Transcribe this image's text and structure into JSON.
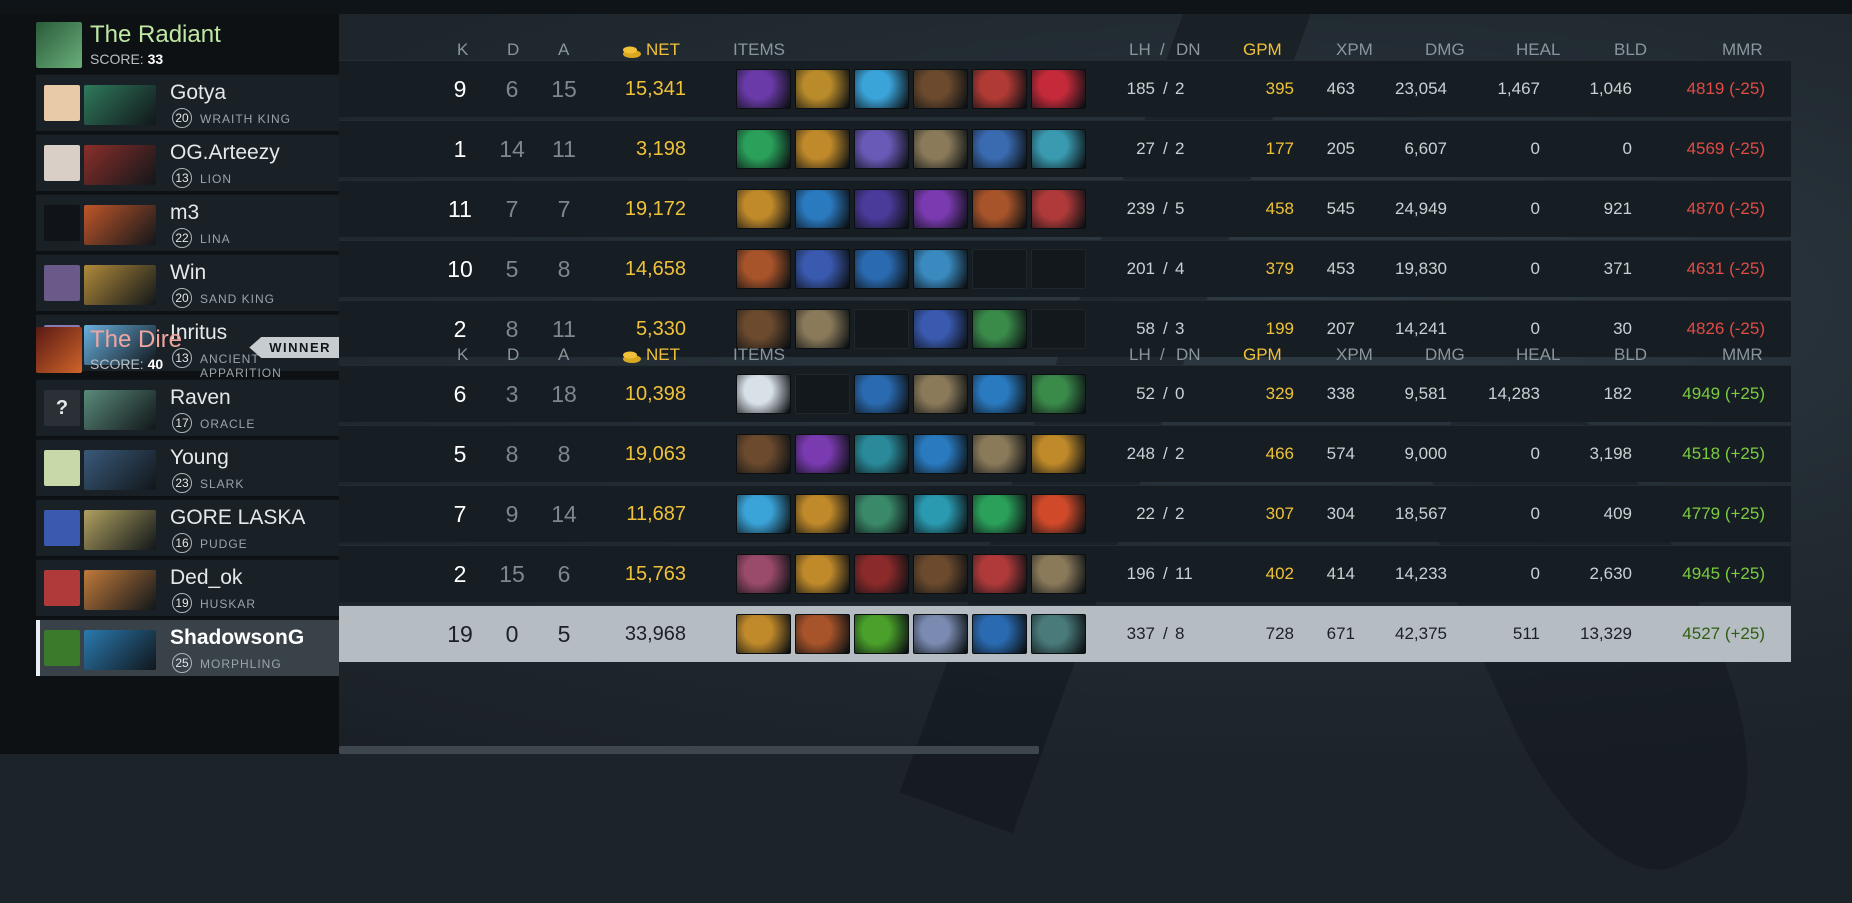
{
  "headers": {
    "k": "K",
    "d": "D",
    "a": "A",
    "net": "NET",
    "items": "ITEMS",
    "lh": "LH",
    "sep": "/",
    "dn": "DN",
    "gpm": "GPM",
    "xpm": "XPM",
    "dmg": "DMG",
    "heal": "HEAL",
    "bld": "BLD",
    "mmr": "MMR"
  },
  "radiant": {
    "name": "The Radiant",
    "score_label": "SCORE:",
    "score": "33",
    "color": "#bfe8a2",
    "players": [
      {
        "name": "Gotya",
        "level": "20",
        "hero": "WRAITH KING",
        "k": "9",
        "d": "6",
        "a": "15",
        "net": "15,341",
        "lh": "185",
        "dn": "2",
        "gpm": "395",
        "xpm": "463",
        "dmg": "23,054",
        "heal": "1,467",
        "bld": "1,046",
        "mmr": "4819 (-25)",
        "avatar_color": "#e8c9a8",
        "hero_color": "#2f7a5c",
        "items": [
          "#6a3aa8",
          "#b98b2a",
          "#3aa3d8",
          "#6b4a2e",
          "#b03a34",
          "#c42a3a"
        ]
      },
      {
        "name": "OG.Arteezy",
        "level": "13",
        "hero": "LION",
        "k": "1",
        "d": "14",
        "a": "11",
        "net": "3,198",
        "lh": "27",
        "dn": "2",
        "gpm": "177",
        "xpm": "205",
        "dmg": "6,607",
        "heal": "0",
        "bld": "0",
        "mmr": "4569 (-25)",
        "avatar_color": "#d9cfc6",
        "hero_color": "#8a2f2a",
        "items": [
          "#2aa05a",
          "#c08a2a",
          "#6a5ab8",
          "#8a7a5a",
          "#3a6ab0",
          "#3a9ab0"
        ]
      },
      {
        "name": "m3",
        "level": "22",
        "hero": "LINA",
        "k": "11",
        "d": "7",
        "a": "7",
        "net": "19,172",
        "lh": "239",
        "dn": "5",
        "gpm": "458",
        "xpm": "545",
        "dmg": "24,949",
        "heal": "0",
        "bld": "921",
        "mmr": "4870 (-25)",
        "avatar_color": "#101418",
        "hero_color": "#c0562a",
        "items": [
          "#c08a2a",
          "#2a7ac0",
          "#4a3a9a",
          "#7a3ab0",
          "#a8542a",
          "#b03a3a"
        ]
      },
      {
        "name": "Win",
        "level": "20",
        "hero": "SAND KING",
        "k": "10",
        "d": "5",
        "a": "8",
        "net": "14,658",
        "lh": "201",
        "dn": "4",
        "gpm": "379",
        "xpm": "453",
        "dmg": "19,830",
        "heal": "0",
        "bld": "371",
        "mmr": "4631 (-25)",
        "avatar_color": "#6a5a8a",
        "hero_color": "#b08a3a",
        "items": [
          "#a8542a",
          "#3a5ab0",
          "#2a6ab0",
          "#3a8ac0",
          "",
          ""
        ]
      },
      {
        "name": "Inritus",
        "level": "13",
        "hero": "ANCIENT APPARITION",
        "k": "2",
        "d": "8",
        "a": "11",
        "net": "5,330",
        "lh": "58",
        "dn": "3",
        "gpm": "199",
        "xpm": "207",
        "dmg": "14,241",
        "heal": "0",
        "bld": "30",
        "mmr": "4826 (-25)",
        "avatar_color": "#8a7ab8",
        "hero_color": "#6ab0e0",
        "items": [
          "#6b4a2e",
          "#8a7a5a",
          "",
          "#3a5ab0",
          "#3a8a4a",
          ""
        ]
      }
    ]
  },
  "dire": {
    "name": "The Dire",
    "score_label": "SCORE:",
    "score": "40",
    "color": "#f0a5a0",
    "winner_label": "WINNER",
    "players": [
      {
        "name": "Raven",
        "level": "17",
        "hero": "ORACLE",
        "k": "6",
        "d": "3",
        "a": "18",
        "net": "10,398",
        "lh": "52",
        "dn": "0",
        "gpm": "329",
        "xpm": "338",
        "dmg": "9,581",
        "heal": "14,283",
        "bld": "182",
        "mmr": "4949 (+25)",
        "avatar_glyph": "?",
        "avatar_color": "#2a3035",
        "hero_color": "#5a8a7a",
        "items": [
          "#d8e0e8",
          "",
          "#2a6ab0",
          "#8a7a5a",
          "#2a7ac0",
          "#3a8a4a"
        ]
      },
      {
        "name": "Young",
        "level": "23",
        "hero": "SLARK",
        "k": "5",
        "d": "8",
        "a": "8",
        "net": "19,063",
        "lh": "248",
        "dn": "2",
        "gpm": "466",
        "xpm": "574",
        "dmg": "9,000",
        "heal": "0",
        "bld": "3,198",
        "mmr": "4518 (+25)",
        "avatar_color": "#c8d8a8",
        "hero_color": "#3a5a7a",
        "items": [
          "#6b4a2e",
          "#7a3ab0",
          "#2a8a9a",
          "#2a7ac0",
          "#8a7a5a",
          "#c08a2a"
        ]
      },
      {
        "name": "GORE LASKA",
        "level": "16",
        "hero": "PUDGE",
        "k": "7",
        "d": "9",
        "a": "14",
        "net": "11,687",
        "lh": "22",
        "dn": "2",
        "gpm": "307",
        "xpm": "304",
        "dmg": "18,567",
        "heal": "0",
        "bld": "409",
        "mmr": "4779 (+25)",
        "avatar_color": "#3a5ab0",
        "hero_color": "#b0a060",
        "items": [
          "#3aa3d8",
          "#c08a2a",
          "#3a8a6a",
          "#2a9ab0",
          "#2aa05a",
          "#d04a2a"
        ]
      },
      {
        "name": "Ded_ok",
        "level": "19",
        "hero": "HUSKAR",
        "k": "2",
        "d": "15",
        "a": "6",
        "net": "15,763",
        "lh": "196",
        "dn": "11",
        "gpm": "402",
        "xpm": "414",
        "dmg": "14,233",
        "heal": "0",
        "bld": "2,630",
        "mmr": "4945 (+25)",
        "avatar_color": "#b03a3a",
        "hero_color": "#c07a3a",
        "items": [
          "#9a4a6a",
          "#c08a2a",
          "#8a2a2a",
          "#6b4a2e",
          "#b03a3a",
          "#8a7a5a"
        ]
      },
      {
        "name": "ShadowsonG",
        "level": "25",
        "hero": "MORPHLING",
        "k": "19",
        "d": "0",
        "a": "5",
        "net": "33,968",
        "lh": "337",
        "dn": "8",
        "gpm": "728",
        "xpm": "671",
        "dmg": "42,375",
        "heal": "511",
        "bld": "13,329",
        "mmr": "4527 (+25)",
        "avatar_color": "#3a7a2a",
        "hero_color": "#2a7ab0",
        "selected": true,
        "items": [
          "#c08a2a",
          "#a8542a",
          "#4aa02a",
          "#7a8ab0",
          "#2a6ab0",
          "#4a7a7a"
        ]
      }
    ]
  },
  "colors": {
    "gold": "#f0c23a",
    "loss": "#e04b45",
    "win": "#7bcc3f"
  },
  "icons": {
    "gold": "gold-coins-icon",
    "radiant_logo": "radiant-logo-icon",
    "dire_logo": "dire-logo-icon"
  }
}
